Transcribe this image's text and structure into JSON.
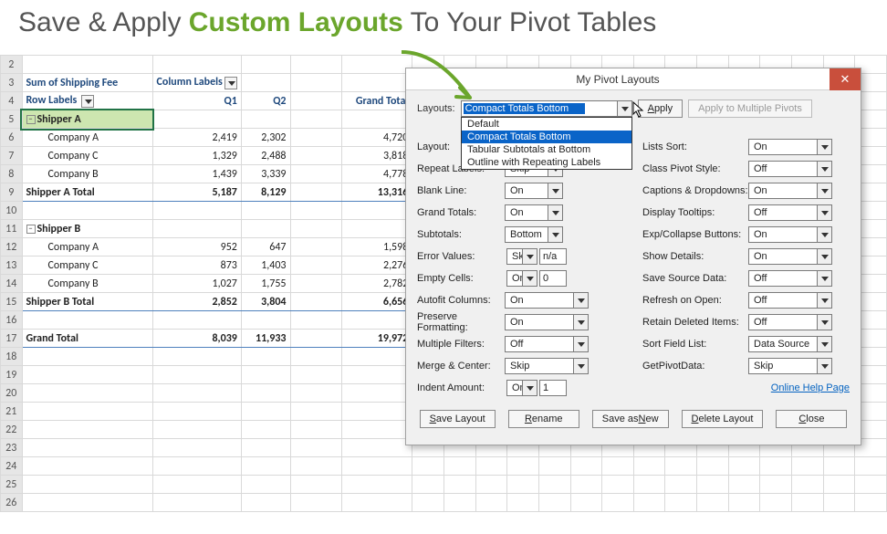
{
  "headline": {
    "pre": "Save & Apply ",
    "accent": "Custom Layouts",
    "post": " To Your Pivot Tables"
  },
  "rowNumbers": [
    "2",
    "3",
    "4",
    "5",
    "6",
    "7",
    "8",
    "9",
    "10",
    "11",
    "12",
    "13",
    "14",
    "15",
    "16",
    "17",
    "18",
    "19",
    "20",
    "21",
    "22",
    "23",
    "24",
    "25",
    "26"
  ],
  "pivot": {
    "measure": "Sum of Shipping Fee",
    "colLabels": "Column Labels",
    "rowLabels": "Row Labels",
    "q1": "Q1",
    "q2": "Q2",
    "grandTotal": "Grand Total",
    "shipperA": "Shipper A",
    "shipperATotal": "Shipper A Total",
    "shipperB": "Shipper B",
    "shipperBTotal": "Shipper B Total",
    "companies": {
      "a": "Company A",
      "b": "Company B",
      "c": "Company C"
    },
    "data": {
      "a_ca": [
        "2,419",
        "2,302",
        "4,720"
      ],
      "a_cc": [
        "1,329",
        "2,488",
        "3,818"
      ],
      "a_cb": [
        "1,439",
        "3,339",
        "4,778"
      ],
      "a_tot": [
        "5,187",
        "8,129",
        "13,316"
      ],
      "b_ca": [
        "952",
        "647",
        "1,598"
      ],
      "b_cc": [
        "873",
        "1,403",
        "2,276"
      ],
      "b_cb": [
        "1,027",
        "1,755",
        "2,782"
      ],
      "b_tot": [
        "2,852",
        "3,804",
        "6,656"
      ],
      "gt": [
        "8,039",
        "11,933",
        "19,972"
      ]
    }
  },
  "dialog": {
    "title": "My Pivot Layouts",
    "layoutsLbl": "Layouts:",
    "selected": "Compact Totals Bottom",
    "applyBtn": "pply",
    "applyUL": "A",
    "multiBtn": "Apply to Multiple Pivots",
    "dropdown": [
      "Default",
      "Compact Totals Bottom",
      "Tabular Subtotals at Bottom",
      "Outline with Repeating Labels"
    ],
    "leftOpts": [
      {
        "label": "Layout:",
        "ctrl": "med",
        "val": ""
      },
      {
        "label": "Repeat Labels:",
        "ctrl": "sm",
        "val": "Skip"
      },
      {
        "label": "Blank Line:",
        "ctrl": "sm",
        "val": "On"
      },
      {
        "label": "Grand Totals:",
        "ctrl": "sm",
        "val": "On"
      },
      {
        "label": "Subtotals:",
        "ctrl": "sm",
        "val": "Bottom"
      },
      {
        "label": "Error Values:",
        "ctrl": "smn+txt",
        "val": "Skip",
        "txt": "n/a"
      },
      {
        "label": "Empty Cells:",
        "ctrl": "smn+txt",
        "val": "On",
        "txt": "0"
      },
      {
        "label": "Autofit Columns:",
        "ctrl": "med",
        "val": "On"
      },
      {
        "label": "Preserve Formatting:",
        "ctrl": "med",
        "val": "On"
      },
      {
        "label": "Multiple Filters:",
        "ctrl": "med",
        "val": "Off"
      },
      {
        "label": "Merge & Center:",
        "ctrl": "med",
        "val": "Skip"
      },
      {
        "label": "Indent Amount:",
        "ctrl": "smn+txt",
        "val": "On",
        "txt": "1"
      }
    ],
    "rightOpts": [
      {
        "label": "Lists Sort:",
        "val": "On"
      },
      {
        "label": "Class Pivot Style:",
        "val": "Off"
      },
      {
        "label": "Captions & Dropdowns:",
        "val": "On"
      },
      {
        "label": "Display Tooltips:",
        "val": "Off"
      },
      {
        "label": "Exp/Collapse Buttons:",
        "val": "On"
      },
      {
        "label": "Show Details:",
        "val": "On"
      },
      {
        "label": "Save Source Data:",
        "val": "Off"
      },
      {
        "label": "Refresh on Open:",
        "val": "Off"
      },
      {
        "label": "Retain Deleted Items:",
        "val": "Off"
      },
      {
        "label": "Sort Field List:",
        "val": "Data Source"
      },
      {
        "label": "GetPivotData:",
        "val": "Skip"
      }
    ],
    "helpLink": "Online Help Page",
    "bottomButtons": [
      {
        "ul": "S",
        "rest": "ave Layout"
      },
      {
        "ul": "R",
        "rest": "ename"
      },
      {
        "ul": "",
        "rest": "Save as ",
        "ul2": "N",
        "rest2": "ew"
      },
      {
        "ul": "D",
        "rest": "elete Layout"
      },
      {
        "ul": "C",
        "rest": "lose"
      }
    ]
  }
}
